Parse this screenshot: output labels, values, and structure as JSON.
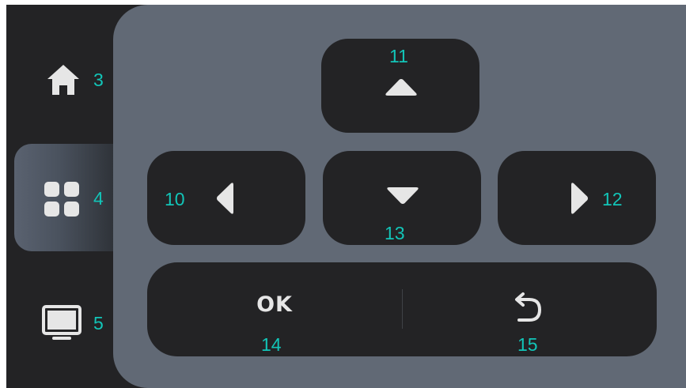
{
  "nav": {
    "home": {
      "label": "3",
      "icon": "home-icon"
    },
    "apps": {
      "label": "4",
      "icon": "apps-grid-icon",
      "selected": true
    },
    "tv": {
      "label": "5",
      "icon": "tv-icon"
    }
  },
  "remote": {
    "up": {
      "label": "11",
      "icon": "triangle-up-icon"
    },
    "left": {
      "label": "10",
      "icon": "triangle-left-icon"
    },
    "down": {
      "label": "13",
      "icon": "triangle-down-icon"
    },
    "right": {
      "label": "12",
      "icon": "triangle-right-icon"
    },
    "ok": {
      "text": "OK",
      "label": "14"
    },
    "back": {
      "label": "15",
      "icon": "back-arrow-icon"
    }
  },
  "colors": {
    "background": "#232325",
    "panel": "#616975",
    "button": "#232325",
    "icon": "#e6e6e6",
    "number_label": "#12c5b8"
  }
}
